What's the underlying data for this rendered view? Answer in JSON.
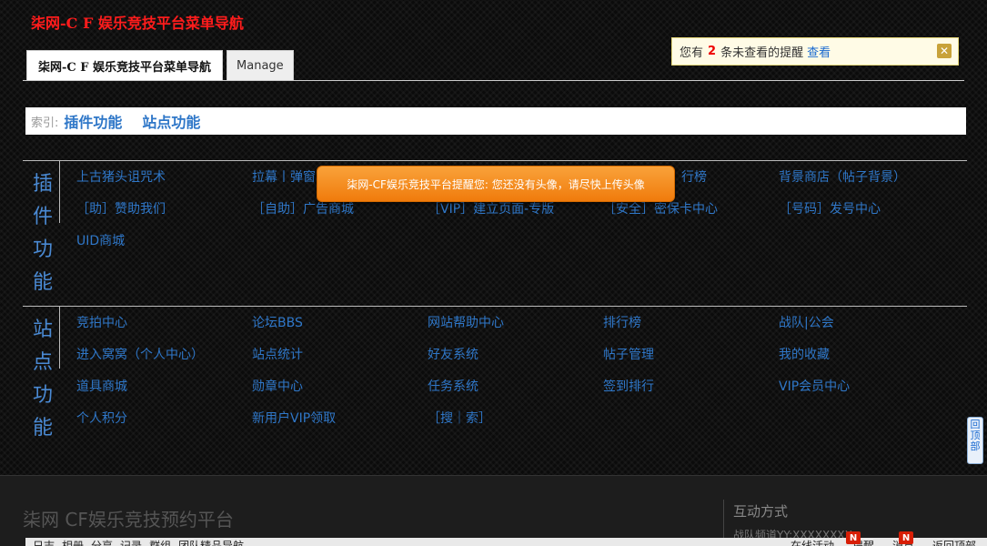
{
  "site": {
    "title": "柒网-C F 娱乐竞技平台菜单导航"
  },
  "tabs": [
    {
      "label": "柒网-C F 娱乐竞技平台菜单导航"
    },
    {
      "label": "Manage"
    }
  ],
  "notice": {
    "prefix": "您有",
    "count": "2",
    "suffix": "条未查看的提醒",
    "view_label": "查看",
    "close_icon": "close-icon"
  },
  "index": {
    "label": "索引:",
    "links": [
      "插件功能",
      "站点功能"
    ]
  },
  "plugins": {
    "label": "插件功能",
    "items": [
      "上古猪头诅咒术",
      "拉幕丨弹窗",
      "",
      "行榜",
      "背景商店（帖子背景）",
      "［助］赞助我们",
      "［自助］广告商城",
      "［VIP］建立页面-专版",
      "［安全］密保卡中心",
      "［号码］发号中心",
      "UID商城"
    ]
  },
  "site_funcs": {
    "label": "站点功能",
    "items": [
      "竞拍中心",
      "论坛BBS",
      "网站帮助中心",
      "排行榜",
      "战队|公会",
      "进入窝窝（个人中心）",
      "站点统计",
      "好友系统",
      "帖子管理",
      "我的收藏",
      "道具商城",
      "勋章中心",
      "任务系统",
      "签到排行",
      "VIP会员中心",
      "个人积分",
      "新用户VIP领取",
      "［搜｜索］"
    ]
  },
  "toast": {
    "text": "柒网-CF娱乐竞技平台提醒您: 您还没有头像，请尽快上传头像"
  },
  "backtop": {
    "label": "回顶部"
  },
  "footer": {
    "brand": "柒网 CF娱乐竞技预约平台",
    "contact_title": "互动方式",
    "contact_sub": "战队频道YY:XXXXXXXX"
  },
  "toolbar": {
    "items": [
      "日志",
      "相册",
      "分享",
      "记录",
      "群组",
      "团队精品导航"
    ],
    "right_items": [
      "在线活动",
      "提醒",
      "消息",
      "返回顶部"
    ],
    "badge": "N"
  }
}
